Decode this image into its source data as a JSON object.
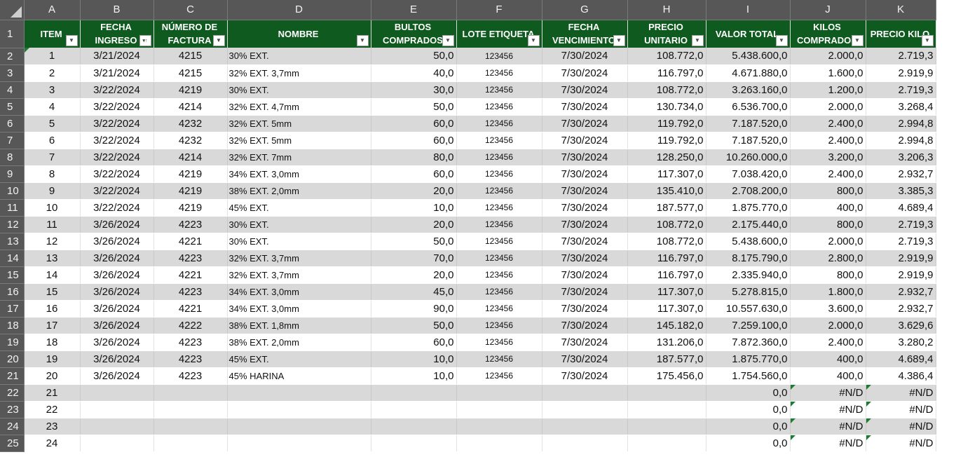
{
  "column_letters": [
    "A",
    "B",
    "C",
    "D",
    "E",
    "F",
    "G",
    "H",
    "I",
    "J",
    "K"
  ],
  "headers": [
    {
      "lines": [
        "ITEM"
      ],
      "filter": "dropdown"
    },
    {
      "lines": [
        "FECHA",
        "INGRESO"
      ],
      "filter": "sorted"
    },
    {
      "lines": [
        "NÚMERO DE",
        "FACTURA"
      ],
      "filter": "dropdown"
    },
    {
      "lines": [
        "NOMBRE"
      ],
      "filter": "dropdown"
    },
    {
      "lines": [
        "BULTOS",
        "COMPRADOS"
      ],
      "filter": "dropdown"
    },
    {
      "lines": [
        "LOTE ETIQUETA"
      ],
      "filter": "dropdown"
    },
    {
      "lines": [
        "FECHA",
        "VENCIMIENTO"
      ],
      "filter": "dropdown"
    },
    {
      "lines": [
        "PRECIO",
        "UNITARIO"
      ],
      "filter": "dropdown"
    },
    {
      "lines": [
        "VALOR TOTAL"
      ],
      "filter": "dropdown"
    },
    {
      "lines": [
        "KILOS",
        "COMPRADOS"
      ],
      "filter": "dropdown"
    },
    {
      "lines": [
        "PRECIO KILO"
      ],
      "filter": "dropdown"
    }
  ],
  "rows": [
    [
      "1",
      "3/21/2024",
      "4215",
      "30% EXT.",
      "50,0",
      "123456",
      "7/30/2024",
      "108.772,0",
      "5.438.600,0",
      "2.000,0",
      "2.719,3"
    ],
    [
      "2",
      "3/21/2024",
      "4215",
      "32% EXT. 3,7mm",
      "40,0",
      "123456",
      "7/30/2024",
      "116.797,0",
      "4.671.880,0",
      "1.600,0",
      "2.919,9"
    ],
    [
      "3",
      "3/22/2024",
      "4219",
      "30% EXT.",
      "30,0",
      "123456",
      "7/30/2024",
      "108.772,0",
      "3.263.160,0",
      "1.200,0",
      "2.719,3"
    ],
    [
      "4",
      "3/22/2024",
      "4214",
      "32% EXT. 4,7mm",
      "50,0",
      "123456",
      "7/30/2024",
      "130.734,0",
      "6.536.700,0",
      "2.000,0",
      "3.268,4"
    ],
    [
      "5",
      "3/22/2024",
      "4232",
      "32% EXT. 5mm",
      "60,0",
      "123456",
      "7/30/2024",
      "119.792,0",
      "7.187.520,0",
      "2.400,0",
      "2.994,8"
    ],
    [
      "6",
      "3/22/2024",
      "4232",
      "32% EXT. 5mm",
      "60,0",
      "123456",
      "7/30/2024",
      "119.792,0",
      "7.187.520,0",
      "2.400,0",
      "2.994,8"
    ],
    [
      "7",
      "3/22/2024",
      "4214",
      "32% EXT. 7mm",
      "80,0",
      "123456",
      "7/30/2024",
      "128.250,0",
      "10.260.000,0",
      "3.200,0",
      "3.206,3"
    ],
    [
      "8",
      "3/22/2024",
      "4219",
      "34% EXT. 3,0mm",
      "60,0",
      "123456",
      "7/30/2024",
      "117.307,0",
      "7.038.420,0",
      "2.400,0",
      "2.932,7"
    ],
    [
      "9",
      "3/22/2024",
      "4219",
      "38% EXT. 2,0mm",
      "20,0",
      "123456",
      "7/30/2024",
      "135.410,0",
      "2.708.200,0",
      "800,0",
      "3.385,3"
    ],
    [
      "10",
      "3/22/2024",
      "4219",
      "45% EXT.",
      "10,0",
      "123456",
      "7/30/2024",
      "187.577,0",
      "1.875.770,0",
      "400,0",
      "4.689,4"
    ],
    [
      "11",
      "3/26/2024",
      "4223",
      "30% EXT.",
      "20,0",
      "123456",
      "7/30/2024",
      "108.772,0",
      "2.175.440,0",
      "800,0",
      "2.719,3"
    ],
    [
      "12",
      "3/26/2024",
      "4221",
      "30% EXT.",
      "50,0",
      "123456",
      "7/30/2024",
      "108.772,0",
      "5.438.600,0",
      "2.000,0",
      "2.719,3"
    ],
    [
      "13",
      "3/26/2024",
      "4223",
      "32% EXT. 3,7mm",
      "70,0",
      "123456",
      "7/30/2024",
      "116.797,0",
      "8.175.790,0",
      "2.800,0",
      "2.919,9"
    ],
    [
      "14",
      "3/26/2024",
      "4221",
      "32% EXT. 3,7mm",
      "20,0",
      "123456",
      "7/30/2024",
      "116.797,0",
      "2.335.940,0",
      "800,0",
      "2.919,9"
    ],
    [
      "15",
      "3/26/2024",
      "4223",
      "34% EXT. 3,0mm",
      "45,0",
      "123456",
      "7/30/2024",
      "117.307,0",
      "5.278.815,0",
      "1.800,0",
      "2.932,7"
    ],
    [
      "16",
      "3/26/2024",
      "4221",
      "34% EXT. 3,0mm",
      "90,0",
      "123456",
      "7/30/2024",
      "117.307,0",
      "10.557.630,0",
      "3.600,0",
      "2.932,7"
    ],
    [
      "17",
      "3/26/2024",
      "4222",
      "38% EXT. 1,8mm",
      "50,0",
      "123456",
      "7/30/2024",
      "145.182,0",
      "7.259.100,0",
      "2.000,0",
      "3.629,6"
    ],
    [
      "18",
      "3/26/2024",
      "4223",
      "38% EXT. 2,0mm",
      "60,0",
      "123456",
      "7/30/2024",
      "131.206,0",
      "7.872.360,0",
      "2.400,0",
      "3.280,2"
    ],
    [
      "19",
      "3/26/2024",
      "4223",
      "45% EXT.",
      "10,0",
      "123456",
      "7/30/2024",
      "187.577,0",
      "1.875.770,0",
      "400,0",
      "4.689,4"
    ],
    [
      "20",
      "3/26/2024",
      "4223",
      "45% HARINA",
      "10,0",
      "123456",
      "7/30/2024",
      "175.456,0",
      "1.754.560,0",
      "400,0",
      "4.386,4"
    ],
    [
      "21",
      "",
      "",
      "",
      "",
      "",
      "",
      "",
      "0,0",
      "#N/D",
      "#N/D"
    ],
    [
      "22",
      "",
      "",
      "",
      "",
      "",
      "",
      "",
      "0,0",
      "#N/D",
      "#N/D"
    ],
    [
      "23",
      "",
      "",
      "",
      "",
      "",
      "",
      "",
      "0,0",
      "#N/D",
      "#N/D"
    ],
    [
      "24",
      "",
      "",
      "",
      "",
      "",
      "",
      "",
      "0,0",
      "#N/D",
      "#N/D"
    ]
  ],
  "colors": {
    "header_fill": "#0f5a1f",
    "band_fill": "#d9d9d9",
    "frame_fill": "#575757",
    "error_marker": "#1e7b34"
  }
}
